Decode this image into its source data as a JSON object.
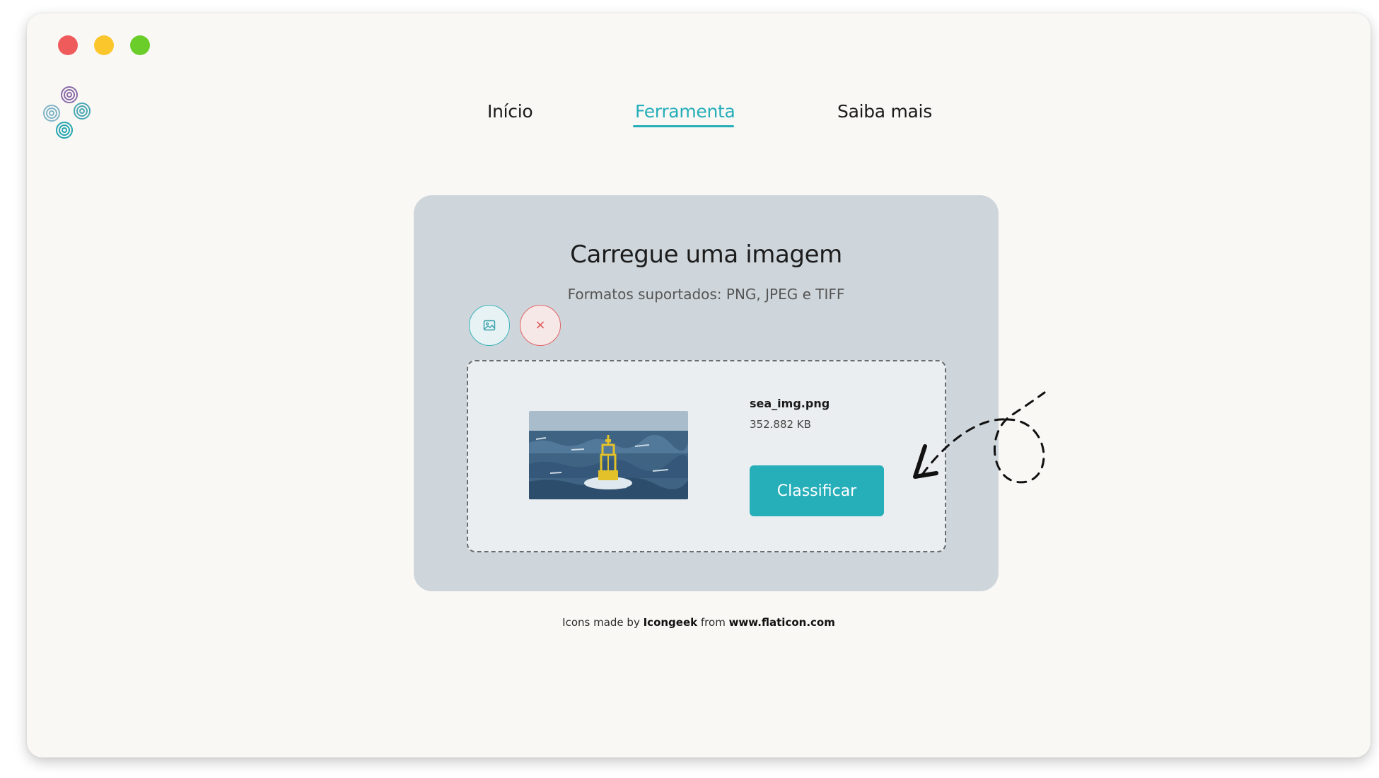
{
  "window": {
    "controls": [
      "close",
      "minimize",
      "maximize"
    ]
  },
  "logo": {
    "icon": "spiral-logo-icon"
  },
  "nav": {
    "items": [
      {
        "label": "Início"
      },
      {
        "label": "Ferramenta",
        "active": true
      },
      {
        "label": "Saiba mais"
      }
    ]
  },
  "upload": {
    "title": "Carregue uma imagem",
    "subtitle": "Formatos suportados: PNG, JPEG e TIFF",
    "select_icon": "image-icon",
    "remove_icon": "close-icon",
    "remove_symbol": "×",
    "file": {
      "name": "sea_img.png",
      "size": "352.882 KB"
    },
    "classify_label": "Classificar"
  },
  "credits": {
    "prefix": "Icons made by ",
    "author": "Icongeek",
    "middle": " from ",
    "site": "www.flaticon.com"
  },
  "colors": {
    "accent": "#26aeb9",
    "danger": "#e05555",
    "card": "#cfd6db",
    "background": "#f9f8f5"
  }
}
